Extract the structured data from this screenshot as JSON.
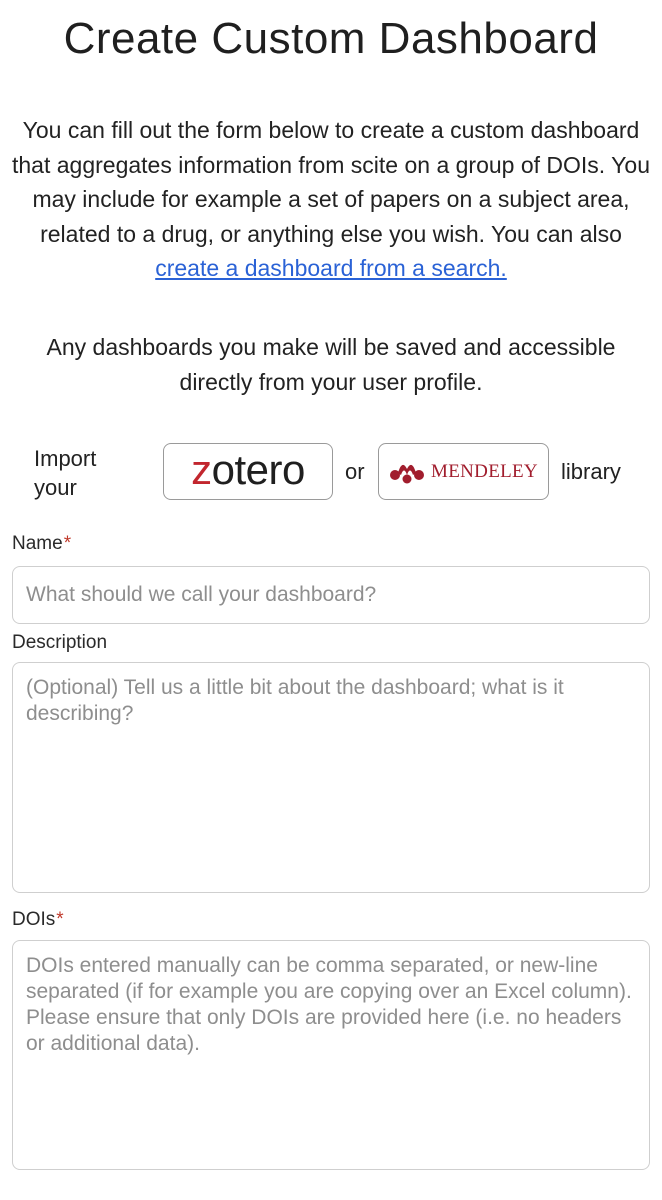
{
  "page": {
    "title": "Create Custom Dashboard"
  },
  "intro": {
    "text": "You can fill out the form below to create a custom dashboard that aggregates information from scite on a group of DOIs. You may include for example a set of papers on a subject area, related to a drug, or anything else you wish. You can also",
    "link_text": "create a dashboard from a search."
  },
  "saved_note": "Any dashboards you make will be saved and accessible directly from your user profile.",
  "import": {
    "label": "Import your",
    "zotero_first_letter": "z",
    "zotero_rest": "otero",
    "or_text": "or",
    "mendeley_label": "MENDELEY",
    "library_text": "library"
  },
  "form": {
    "name": {
      "label": "Name",
      "required_mark": "*",
      "value": "",
      "placeholder": "What should we call your dashboard?"
    },
    "description": {
      "label": "Description",
      "value": "",
      "placeholder": "(Optional) Tell us a little bit about the dashboard; what is it describing?"
    },
    "dois": {
      "label": "DOIs",
      "required_mark": "*",
      "value": "",
      "placeholder": "DOIs entered manually can be comma separated, or new-line separated (if for example you are copying over an Excel column). Please ensure that only DOIs are provided here (i.e. no headers or additional data)."
    }
  },
  "colors": {
    "link": "#2a62d6",
    "zotero_red": "#c2262e",
    "mendeley_red": "#a11d2d",
    "required": "#c0392b"
  },
  "icons": {
    "mendeley_logo": "mendeley-logo-icon"
  }
}
